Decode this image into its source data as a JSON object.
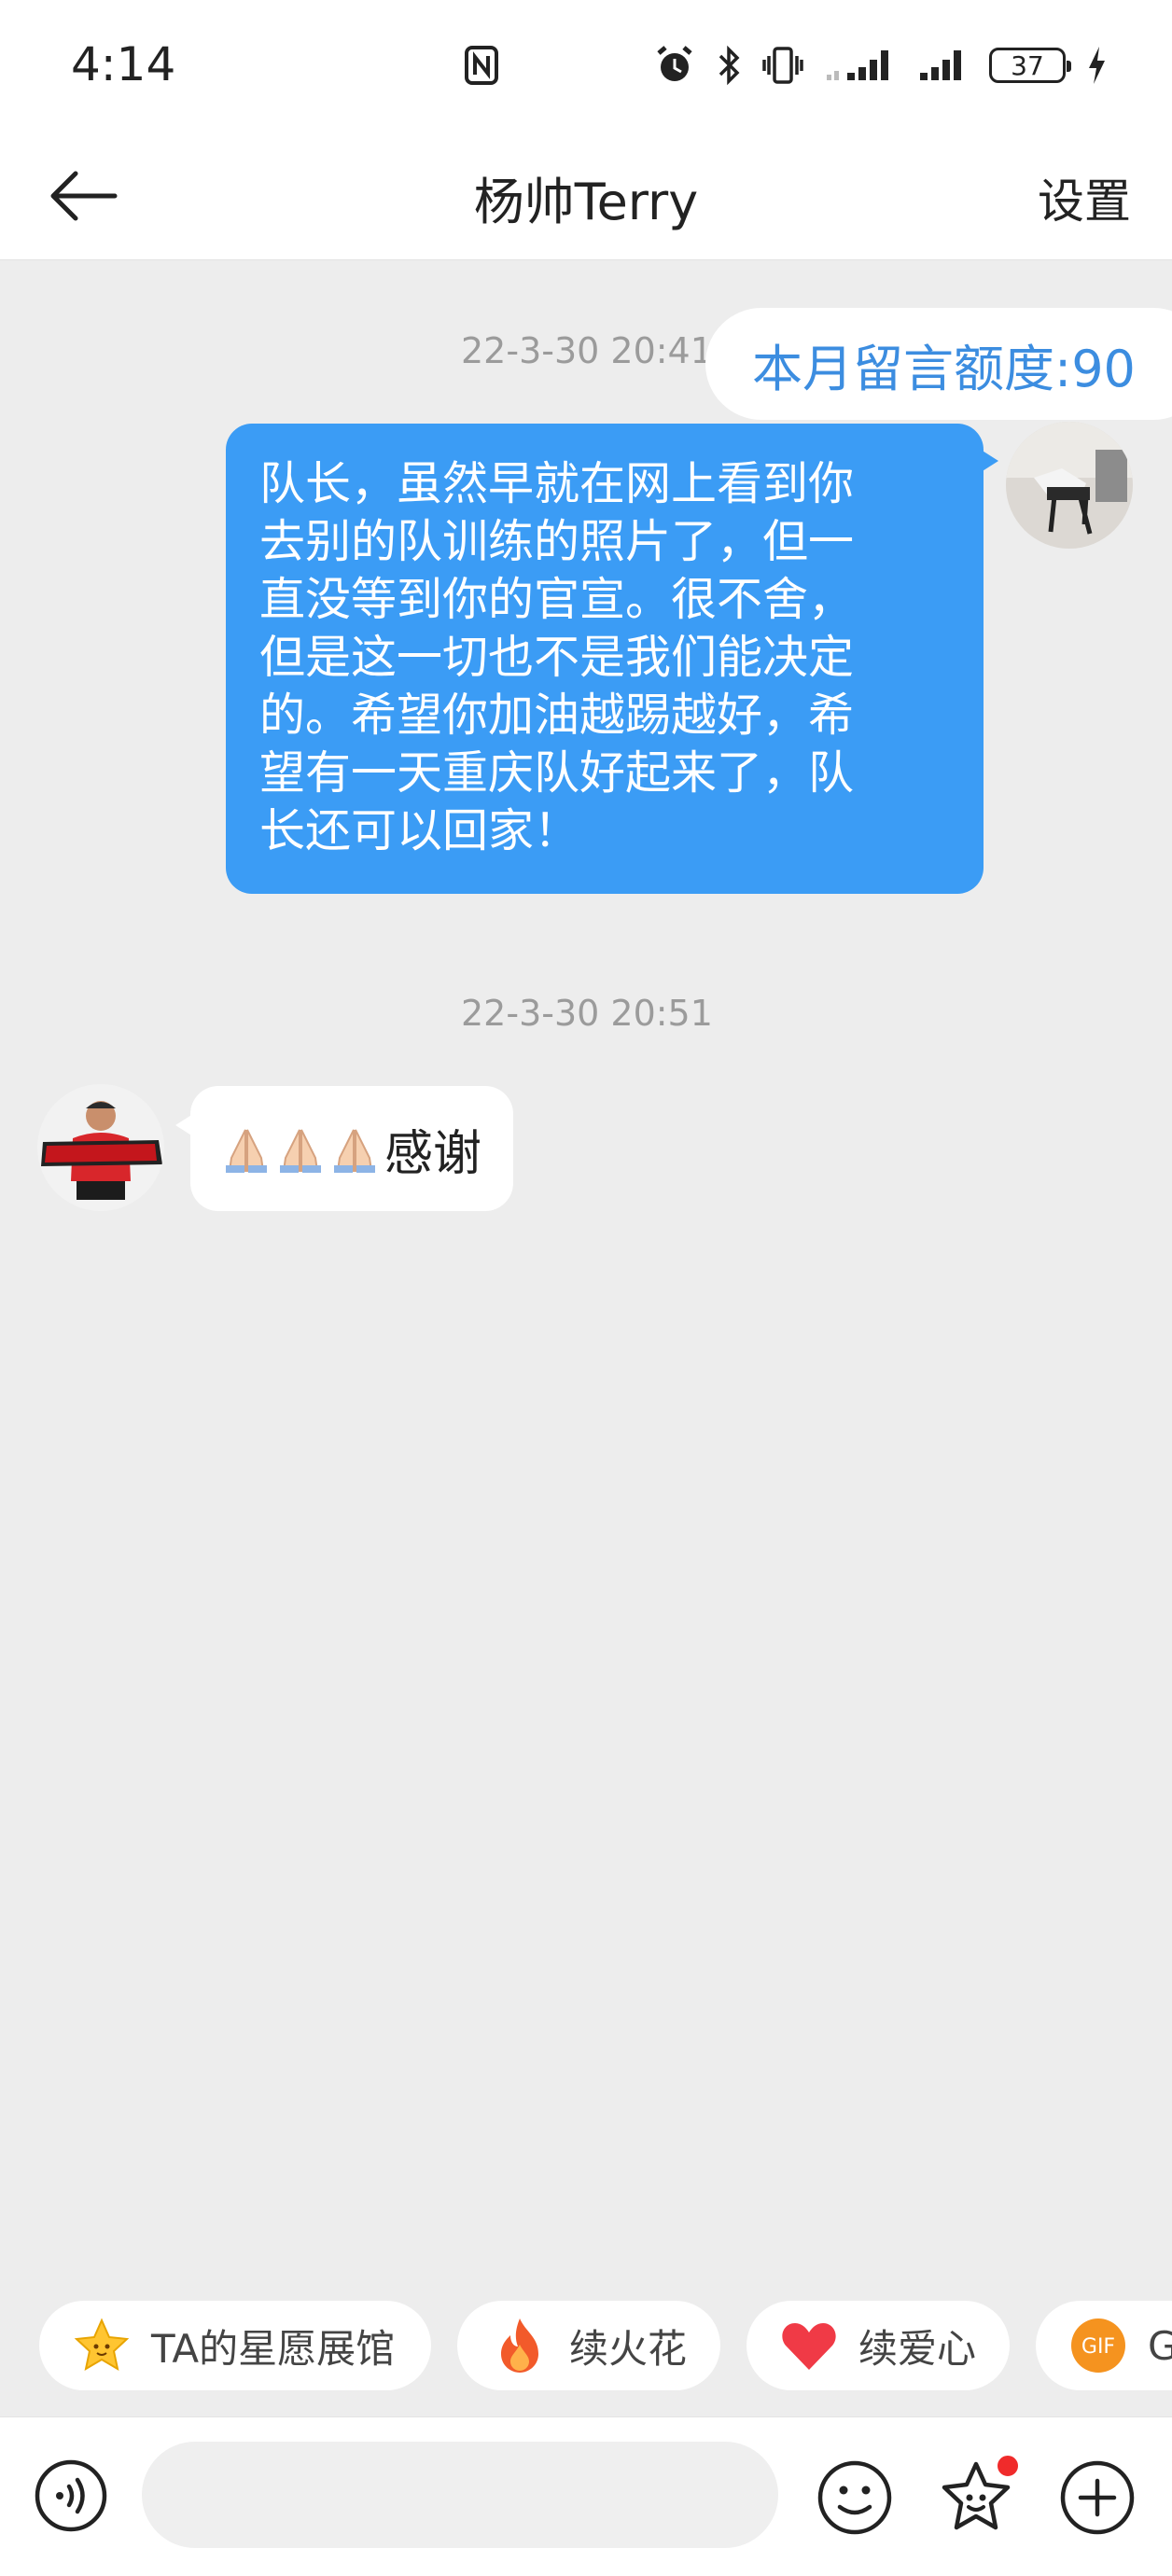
{
  "status_bar": {
    "time": "4:14",
    "battery_level": "37"
  },
  "header": {
    "title": "杨帅Terry",
    "settings_label": "设置"
  },
  "chat": {
    "quota_label": "本月留言额度:90",
    "messages": [
      {
        "timestamp": "22-3-30 20:41",
        "sender": "me",
        "text": "队长，虽然早就在网上看到你\n去别的队训练的照片了，但一\n直没等到你的官宣。很不舍，\n但是这一切也不是我们能决定\n的。希望你加油越踢越好，希\n望有一天重庆队好起来了，队\n长还可以回家！"
      },
      {
        "timestamp": "22-3-30 20:51",
        "sender": "other",
        "text": "感谢",
        "emoji_icon": "folded-hands-icon",
        "emoji_count": 3
      }
    ]
  },
  "quick_actions": [
    {
      "label": "TA的星愿展馆",
      "icon": "star-icon"
    },
    {
      "label": "续火花",
      "icon": "fire-icon"
    },
    {
      "label": "续爱心",
      "icon": "heart-icon"
    },
    {
      "label": "G",
      "icon": "gif-icon",
      "badge_text": "GIF"
    }
  ],
  "input_bar": {
    "placeholder": ""
  },
  "colors": {
    "sent_bubble": "#3b9cf5",
    "quota_text": "#3c8de0",
    "background": "#ededed",
    "notification_dot": "#f02b2b"
  }
}
